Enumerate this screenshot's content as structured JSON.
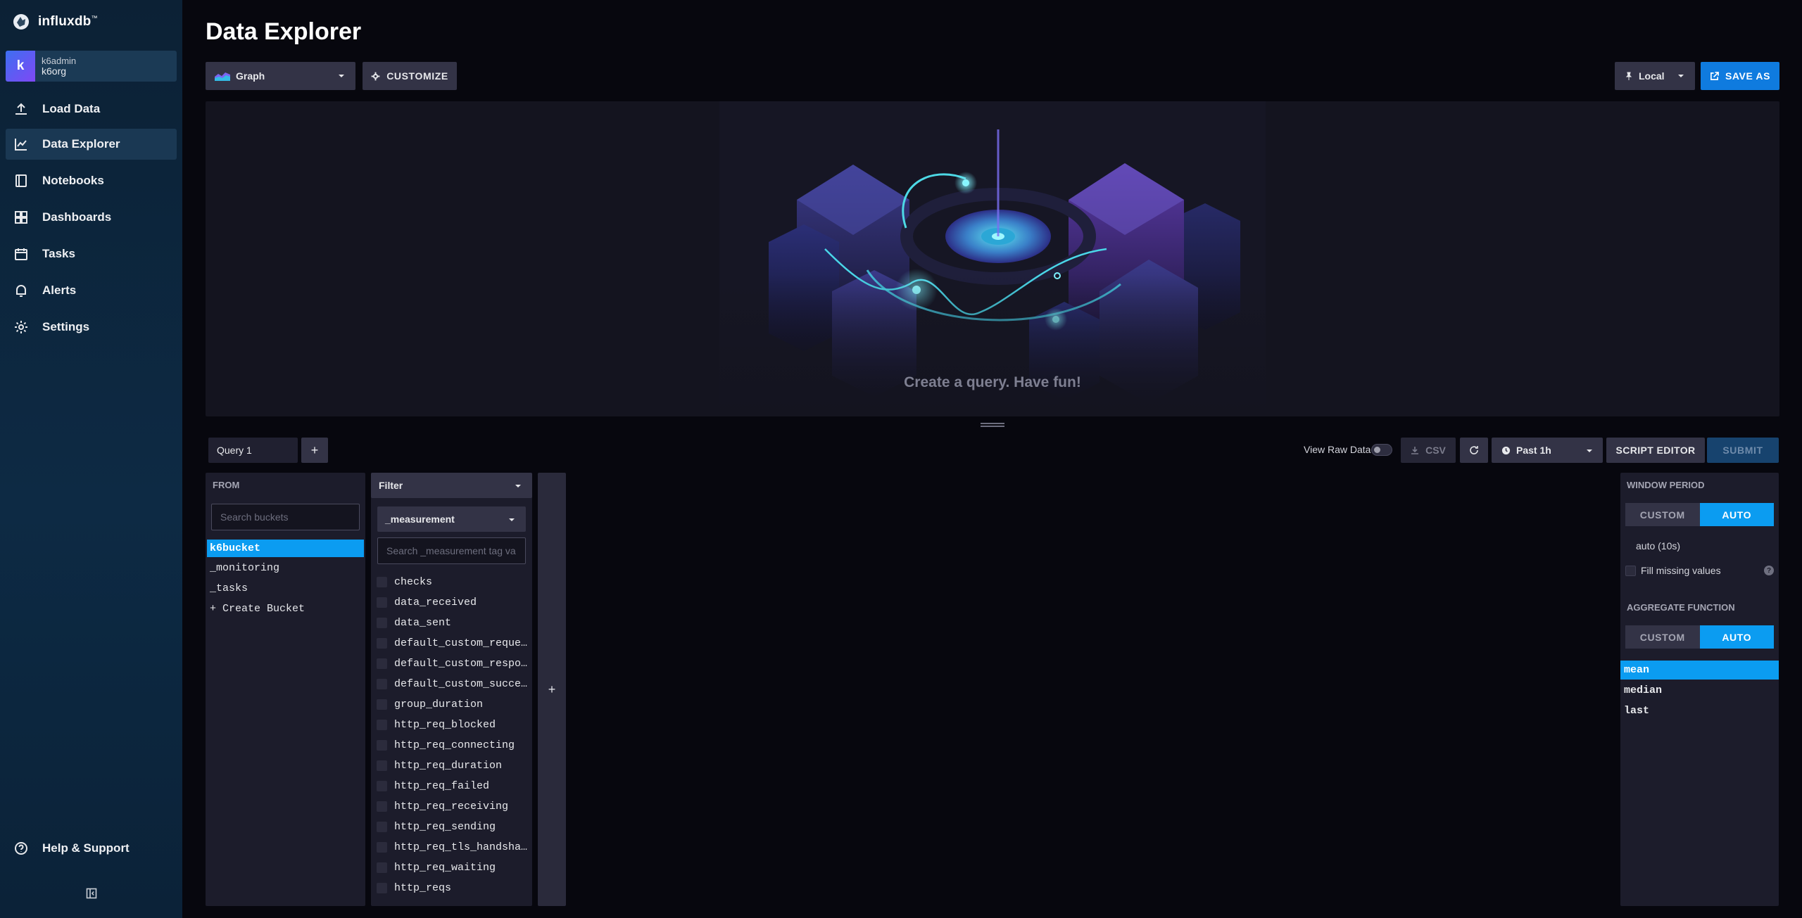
{
  "brand": {
    "name": "influxdb"
  },
  "user": {
    "initial": "k",
    "username": "k6admin",
    "org": "k6org"
  },
  "nav": {
    "items": [
      {
        "label": "Load Data",
        "icon": "upload-icon"
      },
      {
        "label": "Data Explorer",
        "icon": "graph-icon",
        "active": true
      },
      {
        "label": "Notebooks",
        "icon": "notebook-icon"
      },
      {
        "label": "Dashboards",
        "icon": "dashboard-icon"
      },
      {
        "label": "Tasks",
        "icon": "calendar-icon"
      },
      {
        "label": "Alerts",
        "icon": "bell-icon"
      },
      {
        "label": "Settings",
        "icon": "gear-icon"
      }
    ],
    "help": "Help & Support"
  },
  "page": {
    "title": "Data Explorer"
  },
  "toolbar": {
    "viz_type": "Graph",
    "customize": "CUSTOMIZE",
    "timezone": "Local",
    "save_as": "SAVE AS"
  },
  "viz": {
    "empty_message": "Create a query. Have fun!"
  },
  "query_bar": {
    "tab": "Query 1",
    "add": "+",
    "view_raw": "View Raw Data",
    "csv": "CSV",
    "time_range": "Past 1h",
    "script_editor": "SCRIPT EDITOR",
    "submit": "SUBMIT"
  },
  "from": {
    "header": "FROM",
    "search_placeholder": "Search buckets",
    "buckets": [
      "k6bucket",
      "_monitoring",
      "_tasks",
      "+ Create Bucket"
    ],
    "selected": "k6bucket"
  },
  "filter": {
    "mode": "Filter",
    "key": "_measurement",
    "search_placeholder": "Search _measurement tag va",
    "values": [
      "checks",
      "data_received",
      "data_sent",
      "default_custom_reques_",
      "default_custom_respon_",
      "default_custom_succes_",
      "group_duration",
      "http_req_blocked",
      "http_req_connecting",
      "http_req_duration",
      "http_req_failed",
      "http_req_receiving",
      "http_req_sending",
      "http_req_tls_handshak_",
      "http_req_waiting",
      "http_reqs"
    ],
    "add": "+"
  },
  "aggregate": {
    "window_header": "WINDOW PERIOD",
    "custom": "CUSTOM",
    "auto": "AUTO",
    "auto_value": "auto (10s)",
    "fill_missing": "Fill missing values",
    "help": "?",
    "function_header": "AGGREGATE FUNCTION",
    "functions": [
      "mean",
      "median",
      "last"
    ],
    "selected_function": "mean"
  },
  "colors": {
    "sidebar_bg": "#0d2a44",
    "accent": "#0b9cf1",
    "save_button": "#0f7bdf",
    "panel_bg": "#1c1c2b"
  }
}
